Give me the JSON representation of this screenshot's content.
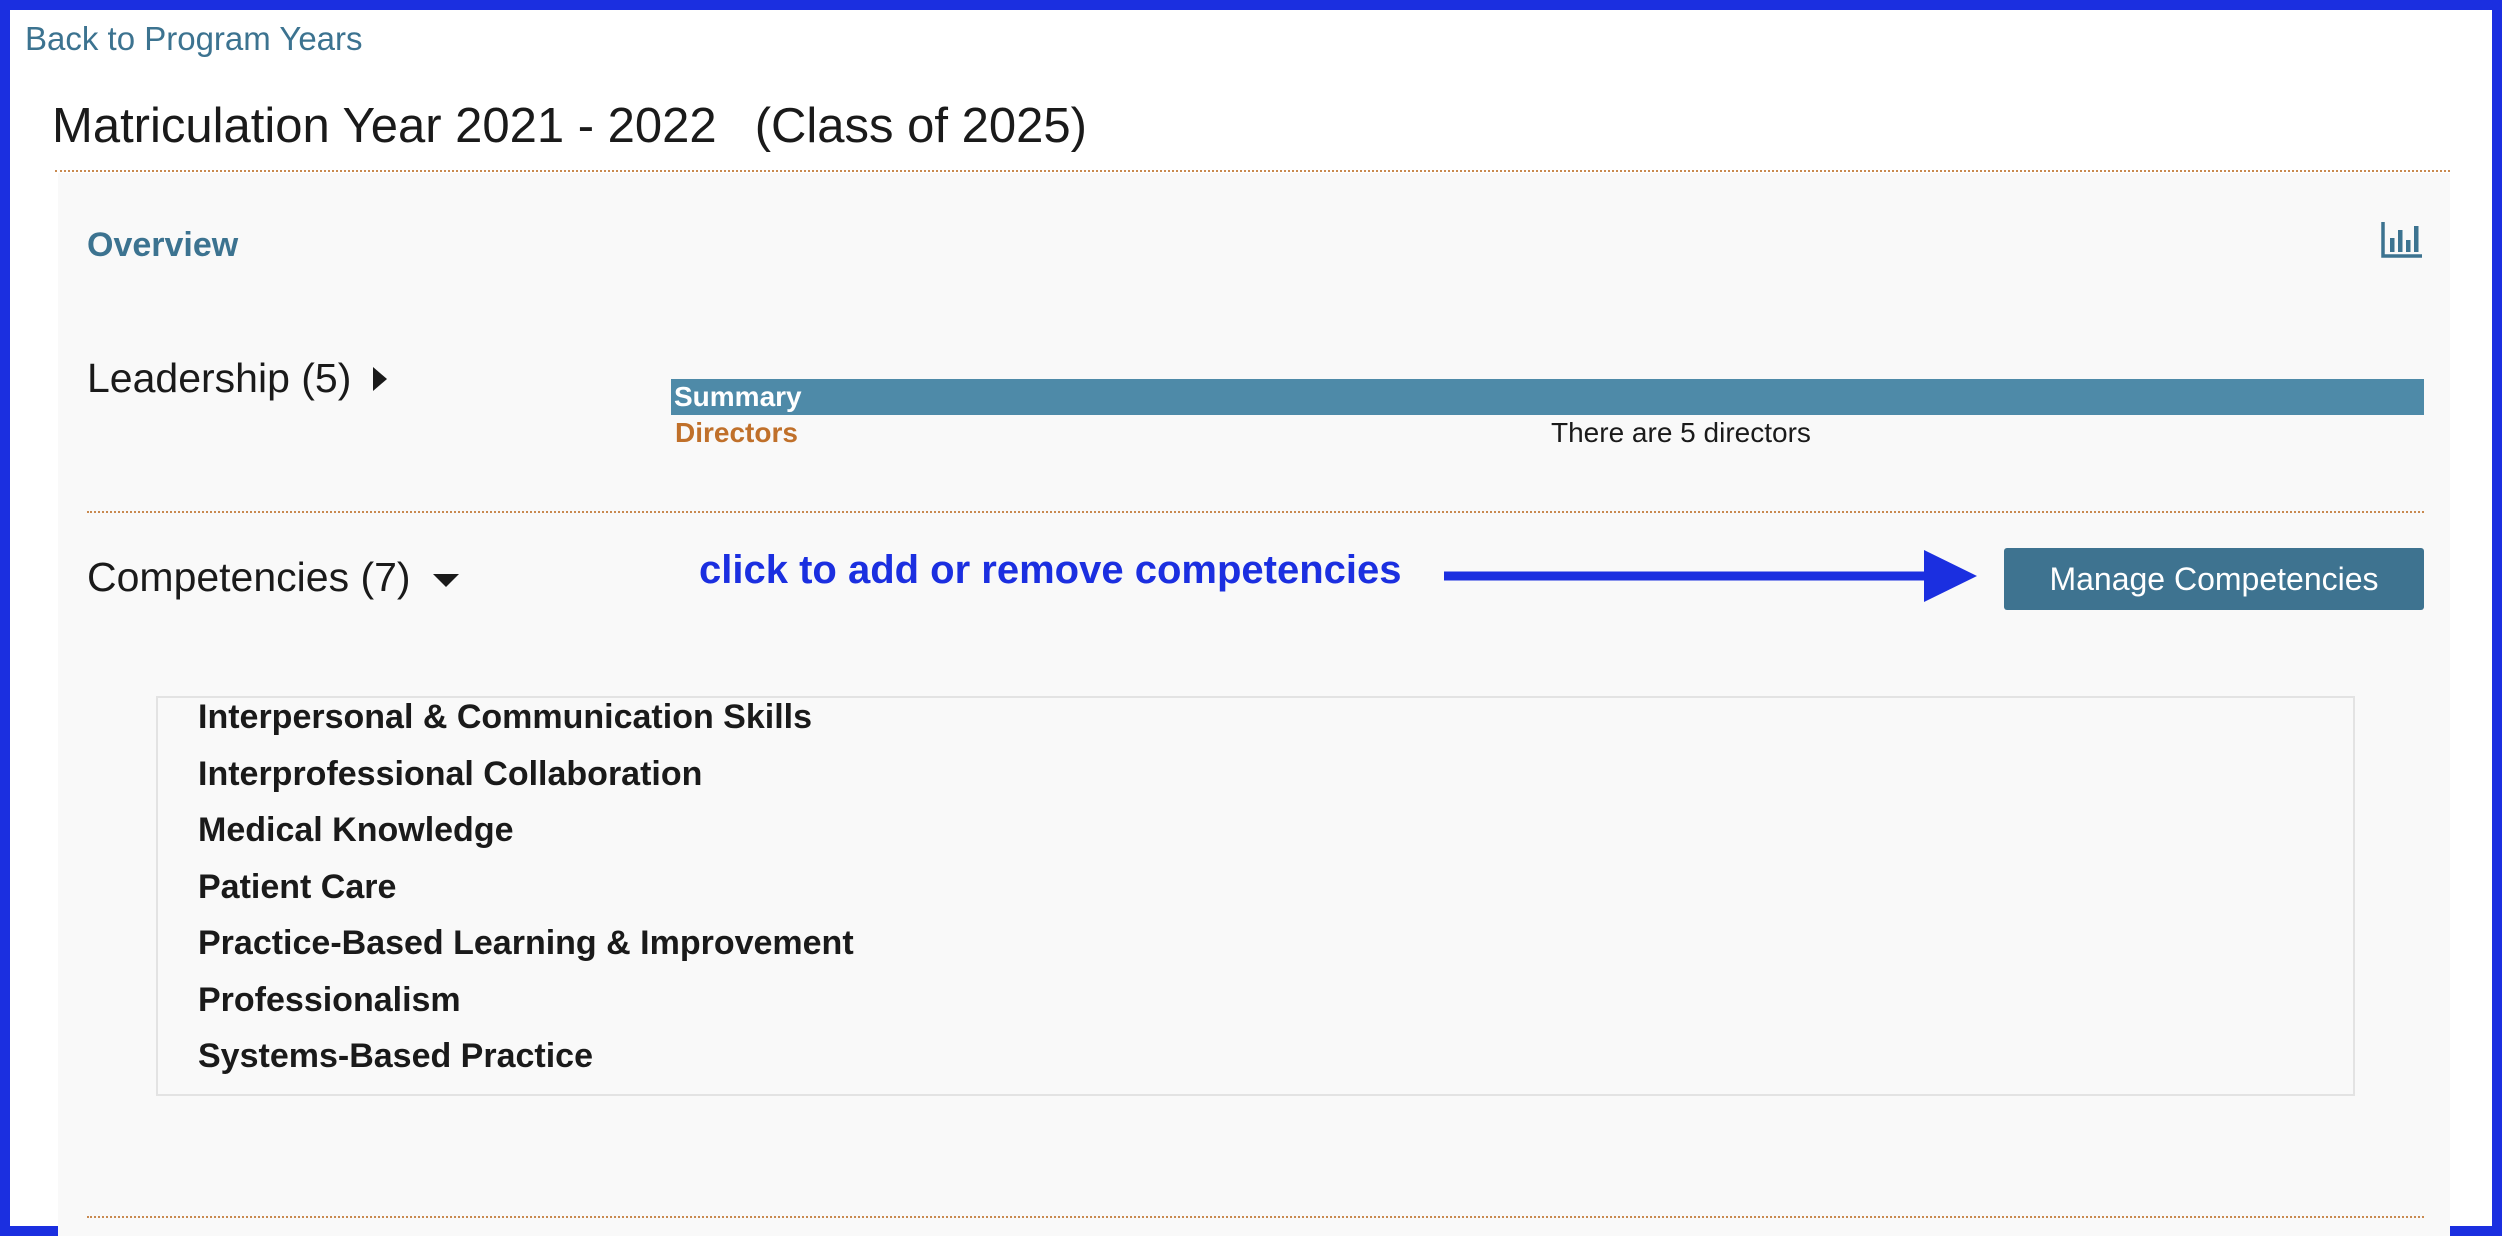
{
  "nav": {
    "back_link": "Back to Program Years"
  },
  "header": {
    "title": "Matriculation Year 2021 - 2022",
    "class_label": "(Class of 2025)"
  },
  "overview": {
    "label": "Overview",
    "chart_icon": "bar-chart-icon"
  },
  "leadership": {
    "title": "Leadership (5)",
    "expanded": false,
    "summary": {
      "header": "Summary",
      "row_label": "Directors",
      "row_value": "There are 5 directors"
    }
  },
  "competencies": {
    "title": "Competencies (7)",
    "expanded": true,
    "annotation": "click to add or remove competencies",
    "manage_button": "Manage Competencies",
    "items": [
      "Interpersonal & Communication Skills",
      "Interprofessional Collaboration",
      "Medical Knowledge",
      "Patient Care",
      "Practice-Based Learning & Improvement",
      "Professionalism",
      "Systems-Based Practice"
    ]
  },
  "colors": {
    "frame": "#1b2fe0",
    "link": "#3c7390",
    "summary_header": "#4e8aa8",
    "director_label": "#c0702a",
    "button": "#3e7390",
    "annotation": "#1b2fe0"
  }
}
